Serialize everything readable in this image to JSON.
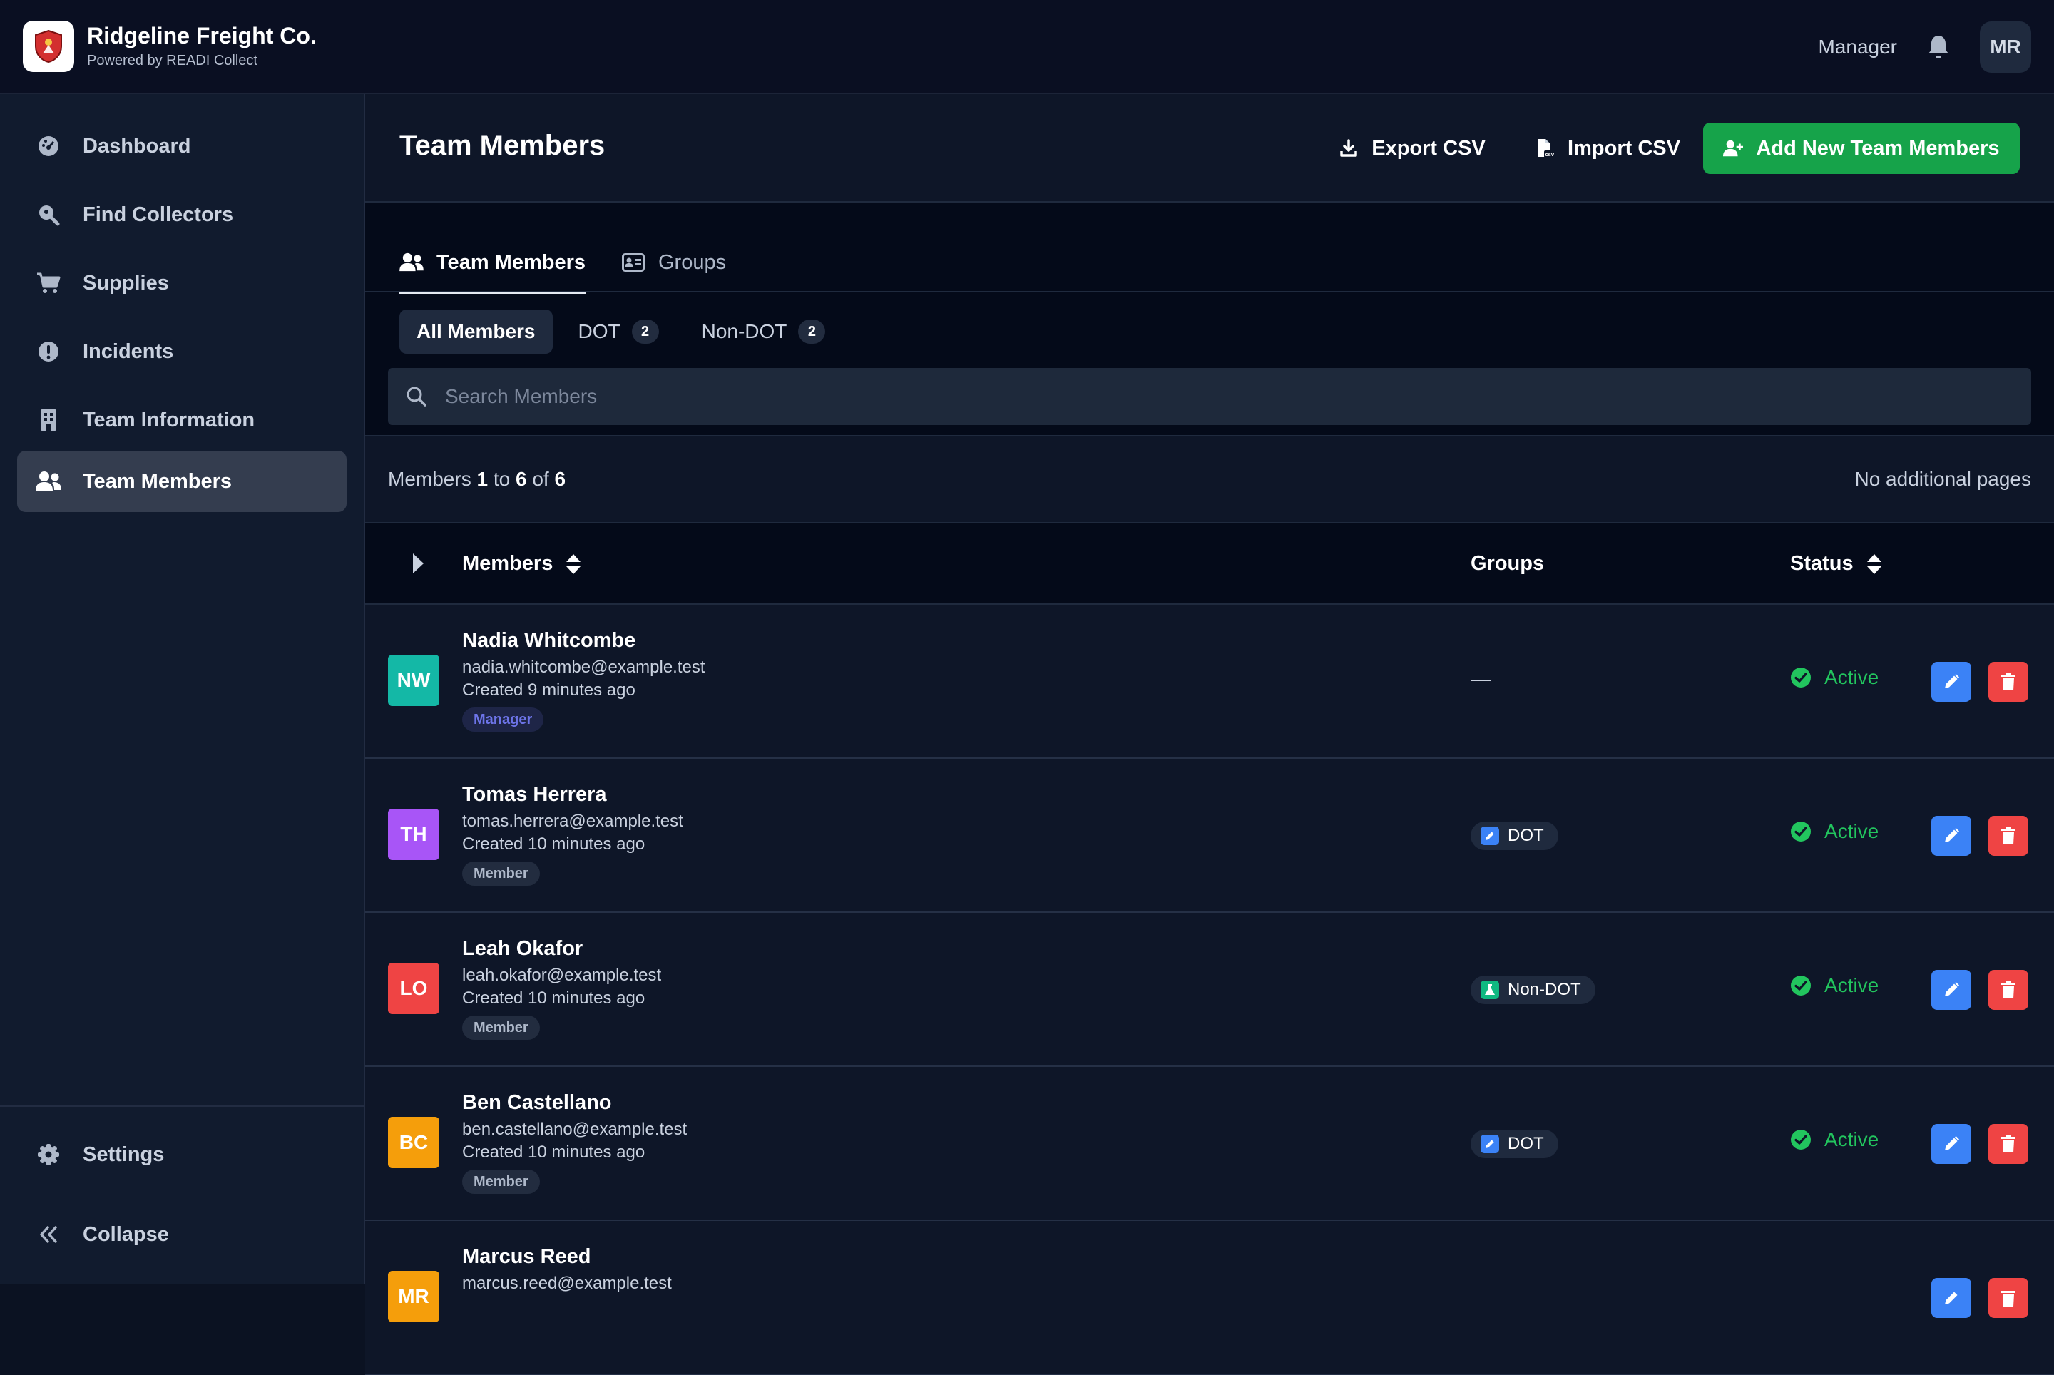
{
  "app": {
    "name": "Ridgeline Freight Co.",
    "subtitle": "Powered by READI Collect",
    "role": "Manager",
    "avatar_initials": "MR"
  },
  "sidebar": {
    "items": [
      {
        "label": "Dashboard",
        "icon": "dashboard-icon"
      },
      {
        "label": "Find Collectors",
        "icon": "search-location-icon"
      },
      {
        "label": "Supplies",
        "icon": "cart-icon"
      },
      {
        "label": "Incidents",
        "icon": "alert-icon"
      },
      {
        "label": "Team Information",
        "icon": "building-icon"
      },
      {
        "label": "Team Members",
        "icon": "users-icon",
        "active": true
      }
    ],
    "bottom": [
      {
        "label": "Settings",
        "icon": "gear-icon"
      },
      {
        "label": "Collapse",
        "icon": "double-chevron-left-icon"
      }
    ]
  },
  "header": {
    "title": "Team Members",
    "export_label": "Export CSV",
    "import_label": "Import CSV",
    "add_label": "Add New Team Members"
  },
  "tabs": [
    {
      "label": "Team Members",
      "active": true
    },
    {
      "label": "Groups",
      "active": false
    }
  ],
  "filters": [
    {
      "label": "All Members",
      "active": true
    },
    {
      "label": "DOT",
      "count": "2"
    },
    {
      "label": "Non-DOT",
      "count": "2"
    }
  ],
  "search": {
    "placeholder": "Search Members",
    "value": ""
  },
  "pagination": {
    "prefix": "Members",
    "start": "1",
    "to": "to",
    "end": "6",
    "of": "of",
    "total": "6",
    "pages_note": "No additional pages"
  },
  "table": {
    "columns": {
      "members": "Members",
      "groups": "Groups",
      "status": "Status"
    },
    "rows": [
      {
        "initials": "NW",
        "color": "#14b8a6",
        "name": "Nadia Whitcombe",
        "email": "nadia.whitcombe@example.test",
        "created": "Created 9 minutes ago",
        "role": "Manager",
        "group": "—",
        "status": "Active"
      },
      {
        "initials": "TH",
        "color": "#a855f7",
        "name": "Tomas Herrera",
        "email": "tomas.herrera@example.test",
        "created": "Created 10 minutes ago",
        "role": "Member",
        "group": "DOT",
        "status": "Active"
      },
      {
        "initials": "LO",
        "color": "#ef4444",
        "name": "Leah Okafor",
        "email": "leah.okafor@example.test",
        "created": "Created 10 minutes ago",
        "role": "Member",
        "group": "Non-DOT",
        "status": "Active"
      },
      {
        "initials": "BC",
        "color": "#f59e0b",
        "name": "Ben Castellano",
        "email": "ben.castellano@example.test",
        "created": "Created 10 minutes ago",
        "role": "Member",
        "group": "DOT",
        "status": "Active"
      },
      {
        "initials": "MR",
        "color": "#f59e0b",
        "name": "Marcus Reed",
        "email": "marcus.reed@example.test",
        "created": "",
        "role": "",
        "group": "",
        "status": ""
      }
    ]
  },
  "colors": {
    "accent_green": "#16a34a",
    "edit_blue": "#3b82f6",
    "delete_red": "#ef4444",
    "status_green": "#22c55e",
    "dot_badge": "#3b82f6",
    "nondot_badge": "#10b981"
  }
}
